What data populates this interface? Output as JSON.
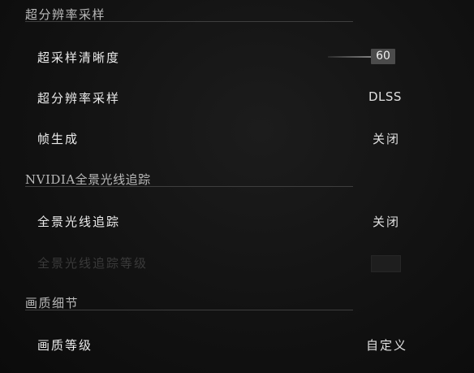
{
  "sections": {
    "super_resolution": {
      "title": "超分辨率采样",
      "rows": {
        "sharpness": {
          "label": "超采样清晰度",
          "value": "60",
          "level_percent": 60
        },
        "upscaler": {
          "label": "超分辨率采样",
          "value": "DLSS"
        },
        "frame_gen": {
          "label": "帧生成",
          "value": "关闭"
        }
      }
    },
    "path_tracing": {
      "title": "NVIDIA全景光线追踪",
      "rows": {
        "path_tracing": {
          "label": "全景光线追踪",
          "value": "关闭"
        },
        "path_tracing_level": {
          "label": "全景光线追踪等级"
        }
      }
    },
    "quality": {
      "title": "画质细节",
      "rows": {
        "quality_level": {
          "label": "画质等级",
          "value": "自定义"
        }
      }
    }
  }
}
